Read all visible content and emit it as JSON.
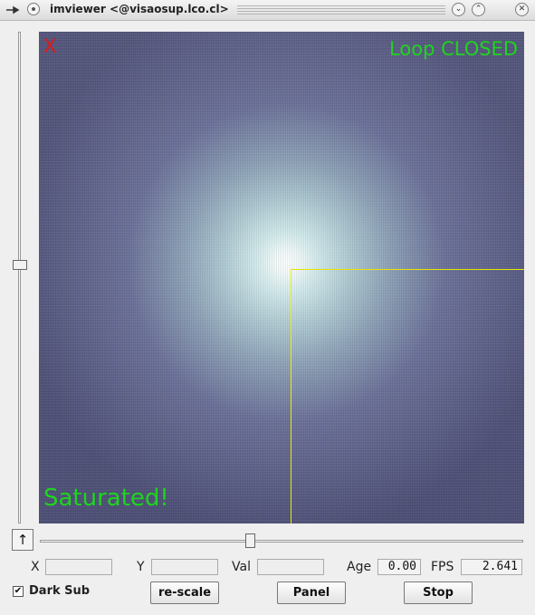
{
  "window": {
    "title": "imviewer <@visaosup.lco.cl>"
  },
  "titlebar_buttons": {
    "minimize": "⌄",
    "maximize": "⌃",
    "close": "✕"
  },
  "overlay": {
    "close_marker": "X",
    "loop_status": "Loop CLOSED",
    "saturation_warning": "Saturated!"
  },
  "colors": {
    "loop_status": "#1fd41f",
    "saturation_warning": "#1fd41f",
    "close_marker": "#e01818",
    "roi_box": "#e5e500"
  },
  "controls": {
    "arrow_button": "↑",
    "x_label": "X",
    "x_value": "",
    "y_label": "Y",
    "y_value": "",
    "val_label": "Val",
    "val_value": "",
    "age_label": "Age",
    "age_value": "0.00",
    "fps_label": "FPS",
    "fps_value": "2.641",
    "dark_sub_label": "Dark Sub",
    "dark_sub_checked": "✔",
    "rescale_label": "re-scale",
    "panel_label": "Panel",
    "stop_label": "Stop"
  },
  "sliders": {
    "vertical_level": 0.47,
    "horizontal_level": 0.43
  }
}
